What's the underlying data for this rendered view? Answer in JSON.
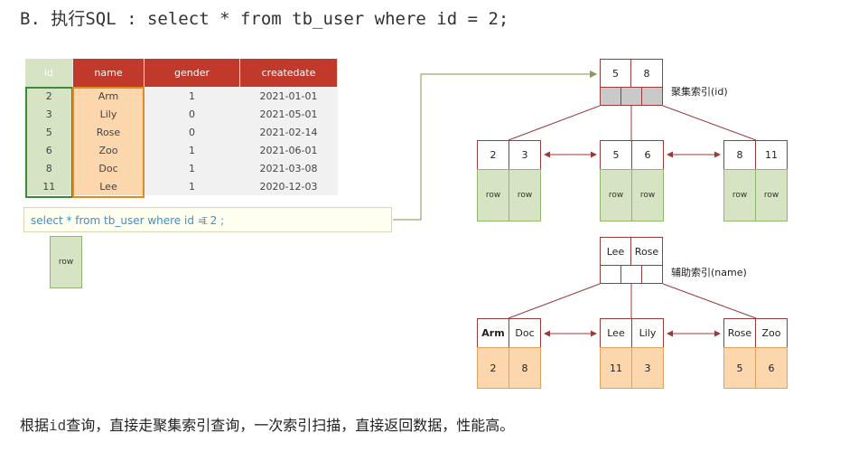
{
  "heading": {
    "prefix": "B.",
    "verb": "执行",
    "sql": "SQL : select * from tb_user where id = 2;"
  },
  "table": {
    "headers": [
      "id",
      "name",
      "gender",
      "createdate"
    ],
    "rows": [
      [
        "2",
        "Arm",
        "1",
        "2021-01-01"
      ],
      [
        "3",
        "Lily",
        "0",
        "2021-05-01"
      ],
      [
        "5",
        "Rose",
        "0",
        "2021-02-14"
      ],
      [
        "6",
        "Zoo",
        "1",
        "2021-06-01"
      ],
      [
        "8",
        "Doc",
        "1",
        "2021-03-08"
      ],
      [
        "11",
        "Lee",
        "1",
        "2020-12-03"
      ]
    ]
  },
  "query_text": "select * from tb_user where id = 2 ;",
  "result_row": "row",
  "clustered_index": {
    "label": "聚集索引(id)",
    "root": [
      "5",
      "8"
    ],
    "leaves": [
      {
        "keys": [
          "2",
          "3"
        ],
        "values": [
          "row",
          "row"
        ]
      },
      {
        "keys": [
          "5",
          "6"
        ],
        "values": [
          "row",
          "row"
        ]
      },
      {
        "keys": [
          "8",
          "11"
        ],
        "values": [
          "row",
          "row"
        ]
      }
    ]
  },
  "secondary_index": {
    "label": "辅助索引(name)",
    "root": [
      "Lee",
      "Rose"
    ],
    "leaves": [
      {
        "keys": [
          "Arm",
          "Doc"
        ],
        "values": [
          "2",
          "8"
        ]
      },
      {
        "keys": [
          "Lee",
          "Lily"
        ],
        "values": [
          "11",
          "3"
        ]
      },
      {
        "keys": [
          "Rose",
          "Zoo"
        ],
        "values": [
          "5",
          "6"
        ]
      }
    ]
  },
  "footer": {
    "part1": "根据",
    "code": "id",
    "part2": "查询，直接走聚集索引查询，一次索引扫描，直接返回数据，性能高。"
  },
  "colors": {
    "header_red": "#c0392b",
    "green": "#d6e4c3",
    "orange": "#fcd6ac",
    "arrow": "#9b3a3a",
    "connector": "#9aaa66"
  }
}
